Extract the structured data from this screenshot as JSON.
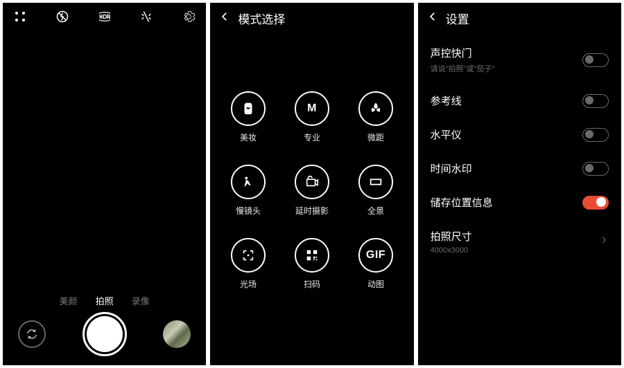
{
  "camera": {
    "tabs": [
      "美颜",
      "拍照",
      "录像"
    ],
    "active_tab_index": 1,
    "top_icons": [
      "modes",
      "flash-off",
      "hdr",
      "filters",
      "settings"
    ]
  },
  "mode_select": {
    "title": "模式选择",
    "items": [
      {
        "icon": "beauty",
        "label": "美妆"
      },
      {
        "icon": "pro-m",
        "label": "专业"
      },
      {
        "icon": "macro",
        "label": "微距"
      },
      {
        "icon": "slowmo",
        "label": "慢镜头"
      },
      {
        "icon": "timelapse",
        "label": "延时摄影"
      },
      {
        "icon": "panorama",
        "label": "全景"
      },
      {
        "icon": "lightfield",
        "label": "光场"
      },
      {
        "icon": "qr",
        "label": "扫码"
      },
      {
        "icon": "gif",
        "label": "动图"
      }
    ]
  },
  "settings": {
    "title": "设置",
    "rows": [
      {
        "title": "声控快门",
        "sub": "请说\"拍照\"或\"茄子\"",
        "type": "toggle",
        "on": false
      },
      {
        "title": "参考线",
        "type": "toggle",
        "on": false
      },
      {
        "title": "水平仪",
        "type": "toggle",
        "on": false
      },
      {
        "title": "时间水印",
        "type": "toggle",
        "on": false
      },
      {
        "title": "储存位置信息",
        "type": "toggle",
        "on": true
      },
      {
        "title": "拍照尺寸",
        "sub": "4000x3000",
        "type": "nav"
      }
    ]
  }
}
